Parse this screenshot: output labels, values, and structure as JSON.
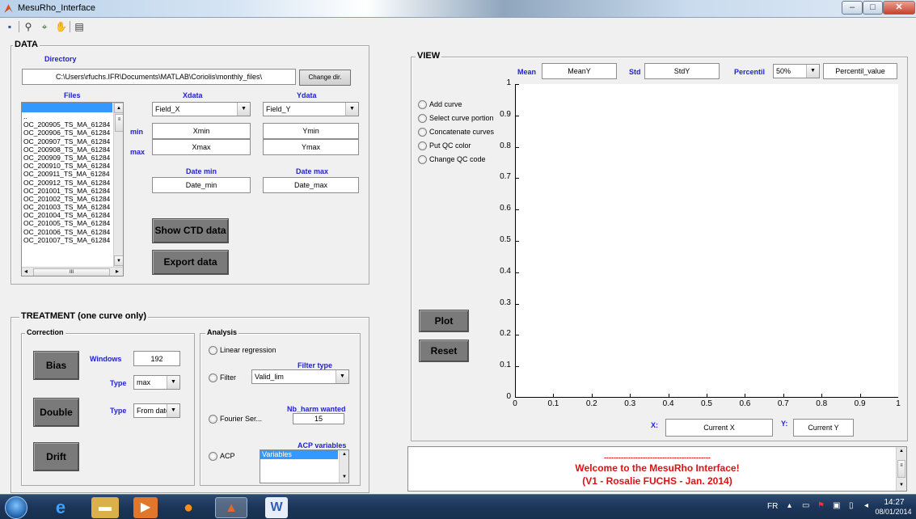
{
  "window": {
    "title": "MesuRho_Interface",
    "minimize": "–",
    "maximize": "□",
    "close": "✕"
  },
  "toolbar": {
    "icons": [
      "save-icon",
      "zoom-icon",
      "datacursor-icon",
      "pan-icon",
      "legend-icon"
    ]
  },
  "data_panel": {
    "title": "DATA",
    "directory_label": "Directory",
    "directory_path": "C:\\Users\\rfuchs.IFR\\Documents\\MATLAB\\Coriolis\\monthly_files\\",
    "change_dir_label": "Change dir.",
    "files_label": "Files",
    "files": [
      "",
      "..",
      "OC_200905_TS_MA_61284",
      "OC_200906_TS_MA_61284",
      "OC_200907_TS_MA_61284",
      "OC_200908_TS_MA_61284",
      "OC_200909_TS_MA_61284",
      "OC_200910_TS_MA_61284",
      "OC_200911_TS_MA_61284",
      "OC_200912_TS_MA_61284",
      "OC_201001_TS_MA_61284",
      "OC_201002_TS_MA_61284",
      "OC_201003_TS_MA_61284",
      "OC_201004_TS_MA_61284",
      "OC_201005_TS_MA_61284",
      "OC_201006_TS_MA_61284",
      "OC_201007_TS_MA_61284"
    ],
    "scroll_h_mark": "III",
    "xdata_label": "Xdata",
    "ydata_label": "Ydata",
    "xdata_value": "Field_X",
    "ydata_value": "Field_Y",
    "min_label": "min",
    "max_label": "max",
    "xmin": "Xmin",
    "ymin": "Ymin",
    "xmax": "Xmax",
    "ymax": "Ymax",
    "date_min_label": "Date min",
    "date_max_label": "Date max",
    "date_min_value": "Date_min",
    "date_max_value": "Date_max",
    "show_ctd_label": "Show CTD data",
    "export_label": "Export data"
  },
  "treatment": {
    "title": "TREATMENT (one curve only)",
    "correction_title": "Correction",
    "bias_label": "Bias",
    "double_label": "Double",
    "drift_label": "Drift",
    "windows_label": "Windows",
    "windows_value": "192",
    "type_label": "Type",
    "type1_value": "max",
    "type2_value": "From date",
    "analysis_title": "Analysis",
    "linear_label": "Linear regression",
    "filter_label": "Filter",
    "filter_type_label": "Filter type",
    "filter_type_value": "Valid_lim",
    "fourier_label": "Fourier Ser...",
    "nb_harm_label": "Nb_harm wanted",
    "nb_harm_value": "15",
    "acp_label": "ACP",
    "acp_vars_label": "ACP variables",
    "acp_vars_value": "Variables"
  },
  "view": {
    "title": "VIEW",
    "mean_label": "Mean",
    "mean_value": "MeanY",
    "std_label": "Std",
    "std_value": "StdY",
    "percentil_label": "Percentil",
    "percentil_select": "50%",
    "percentil_value": "Percentil_value",
    "radios": [
      "Add curve",
      "Select curve portion",
      "Concatenate curves",
      "Put QC color",
      "Change QC code"
    ],
    "plot_label": "Plot",
    "reset_label": "Reset",
    "x_label": "X:",
    "x_value": "Current X",
    "y_label": "Y:",
    "y_value": "Current Y"
  },
  "chart_data": {
    "type": "line",
    "xlim": [
      0,
      1
    ],
    "ylim": [
      0,
      1
    ],
    "xticks": [
      "0",
      "0.1",
      "0.2",
      "0.3",
      "0.4",
      "0.5",
      "0.6",
      "0.7",
      "0.8",
      "0.9",
      "1"
    ],
    "yticks": [
      "0",
      "0.1",
      "0.2",
      "0.3",
      "0.4",
      "0.5",
      "0.6",
      "0.7",
      "0.8",
      "0.9",
      "1"
    ],
    "series": []
  },
  "welcome": {
    "dashes": "--------------------------------------------",
    "line1": "Welcome to the MesuRho Interface!",
    "line2": "(V1 - Rosalie FUCHS - Jan. 2014)"
  },
  "taskbar": {
    "lang": "FR",
    "time": "14:27",
    "date": "08/01/2014",
    "apps": [
      "ie-icon",
      "explorer-icon",
      "media-player-icon",
      "firefox-icon",
      "matlab-icon",
      "word-icon"
    ]
  }
}
